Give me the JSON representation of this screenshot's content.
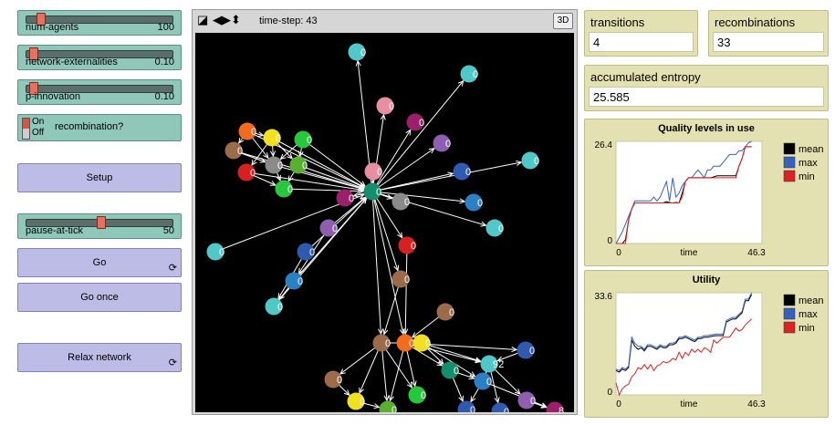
{
  "sliders": [
    {
      "name": "num-agents",
      "value": "100",
      "fraction": 0.12
    },
    {
      "name": "network-externalities",
      "value": "0.10",
      "fraction": 0.05
    },
    {
      "name": "p-innovation",
      "value": "0.10",
      "fraction": 0.05
    }
  ],
  "recombination_switch": {
    "on_label": "On",
    "off_label": "Off",
    "label": "recombination?",
    "state": "on"
  },
  "setup_button": {
    "label": "Setup"
  },
  "pause_slider": {
    "name": "pause-at-tick",
    "value": "50",
    "fraction": 0.5
  },
  "go_button": {
    "label": "Go",
    "forever_icon": "forever-icon"
  },
  "go_once_button": {
    "label": "Go once"
  },
  "relax_button": {
    "label": "Relax network",
    "forever_icon": "forever-icon"
  },
  "view": {
    "time_step": "time-step: 43",
    "three_d_label": "3D",
    "icons": [
      "turtle-shape-icon",
      "horizontal-arrows-icon",
      "vertical-arrows-icon"
    ],
    "nodes": [
      {
        "color": "#50c8c8",
        "label": "0"
      },
      {
        "color": "#50c8c8",
        "label": "0"
      },
      {
        "color": "#e88ea0",
        "label": "0"
      },
      {
        "color": "#9b1f6a",
        "label": "0"
      },
      {
        "color": "#8e5fb0",
        "label": "0"
      },
      {
        "color": "#f26b1e",
        "label": "0"
      },
      {
        "color": "#f0e020",
        "label": "0"
      },
      {
        "color": "#28c83c",
        "label": "0"
      },
      {
        "color": "#9c6b4a",
        "label": "0"
      },
      {
        "color": "#8a8a8a",
        "label": "0"
      },
      {
        "color": "#58b030",
        "label": "0"
      },
      {
        "color": "#d82020",
        "label": "0"
      },
      {
        "color": "#28c83c",
        "label": "0"
      },
      {
        "color": "#e88ea0",
        "label": "0"
      },
      {
        "color": "#50c8c8",
        "label": "0"
      },
      {
        "color": "#2f5ab0",
        "label": "0"
      },
      {
        "color": "#9b1f6a",
        "label": "0"
      },
      {
        "color": "#148f6e",
        "label": "0"
      },
      {
        "color": "#8a8a8a",
        "label": "0"
      },
      {
        "color": "#2b7fc4",
        "label": "0"
      },
      {
        "color": "#50c8c8",
        "label": "0"
      },
      {
        "color": "#8e5fb0",
        "label": "0"
      },
      {
        "color": "#50c8c8",
        "label": "0"
      },
      {
        "color": "#2f5ab0",
        "label": "0"
      },
      {
        "color": "#d82020",
        "label": "0"
      },
      {
        "color": "#2b7fc4",
        "label": "0"
      },
      {
        "color": "#9c6b4a",
        "label": "0"
      },
      {
        "color": "#50c8c8",
        "label": "0"
      },
      {
        "color": "#9c6b4a",
        "label": "0"
      },
      {
        "color": "#9c6b4a",
        "label": "0"
      },
      {
        "color": "#f26b1e",
        "label": "0"
      },
      {
        "color": "#f0e020",
        "label": "0"
      },
      {
        "color": "#148f6e",
        "label": "0"
      },
      {
        "color": "#50c8c8",
        "label": "92"
      },
      {
        "color": "#2f5ab0",
        "label": "0"
      },
      {
        "color": "#2b7fc4",
        "label": "0"
      },
      {
        "color": "#9c6b4a",
        "label": "0"
      },
      {
        "color": "#f0e020",
        "label": "0"
      },
      {
        "color": "#28c83c",
        "label": "0"
      },
      {
        "color": "#58b030",
        "label": "0"
      },
      {
        "color": "#2f5ab0",
        "label": "0"
      },
      {
        "color": "#2f5ab0",
        "label": "0"
      },
      {
        "color": "#8e5fb0",
        "label": "0"
      },
      {
        "color": "#9b1f6a",
        "label": "8"
      }
    ]
  },
  "monitors": {
    "transitions": {
      "label": "transitions",
      "value": "4"
    },
    "recombinations": {
      "label": "recombinations",
      "value": "33"
    },
    "entropy": {
      "label": "accumulated entropy",
      "value": "25.585"
    }
  },
  "chart_data": [
    {
      "type": "line",
      "title": "Quality levels in use",
      "xlabel": "time",
      "ylabel": "",
      "xlim": [
        0,
        46.3
      ],
      "ylim": [
        0,
        26.4
      ],
      "x_tick_labels": [
        "0",
        "46.3"
      ],
      "y_tick_labels": [
        "26.4",
        "0"
      ],
      "legend_position": "right",
      "series": [
        {
          "name": "mean",
          "color": "#000000",
          "x": [
            0,
            2,
            3,
            4,
            5,
            6,
            7,
            8,
            9,
            10,
            11,
            12,
            13,
            14,
            15,
            16,
            17,
            18,
            19,
            20,
            21,
            22,
            23,
            24,
            25,
            26,
            27,
            28,
            29,
            30,
            31,
            32,
            33,
            34,
            35,
            36,
            37,
            38,
            39,
            40,
            41,
            42,
            43
          ],
          "y": [
            0,
            0,
            1,
            6,
            9,
            10.5,
            10.5,
            10.5,
            10.5,
            10.5,
            10.5,
            10.5,
            10.5,
            10.5,
            10.5,
            10.8,
            10.6,
            10.5,
            10.6,
            10.5,
            13,
            16,
            17,
            17,
            17,
            17,
            17,
            17,
            17,
            17,
            17.2,
            17.5,
            17.5,
            17.5,
            17.5,
            17.5,
            17.5,
            17.5,
            20,
            22,
            25,
            25,
            25
          ]
        },
        {
          "name": "max",
          "color": "#3560c0",
          "x": [
            0,
            2,
            3,
            4,
            5,
            6,
            7,
            8,
            9,
            10,
            11,
            12,
            13,
            14,
            15,
            16,
            17,
            18,
            19,
            20,
            21,
            22,
            23,
            24,
            25,
            26,
            27,
            28,
            29,
            30,
            31,
            32,
            33,
            34,
            35,
            36,
            37,
            38,
            39,
            40,
            41,
            42,
            43
          ],
          "y": [
            0,
            3,
            5,
            7,
            9,
            11,
            11,
            11,
            11,
            11,
            11,
            12,
            11,
            12,
            14,
            16,
            11,
            17,
            12,
            13,
            15,
            16,
            17,
            17,
            18,
            19,
            18,
            17,
            19,
            19,
            20,
            20,
            20,
            21,
            22,
            23,
            23,
            23,
            24,
            24,
            25,
            26,
            26.4
          ]
        },
        {
          "name": "min",
          "color": "#dd2222",
          "x": [
            0,
            2,
            3,
            4,
            5,
            6,
            7,
            8,
            9,
            10,
            11,
            12,
            13,
            14,
            15,
            16,
            17,
            18,
            19,
            20,
            21,
            22,
            23,
            24,
            25,
            26,
            27,
            28,
            29,
            30,
            31,
            32,
            33,
            34,
            35,
            36,
            37,
            38,
            39,
            40,
            41,
            42,
            43
          ],
          "y": [
            0,
            0,
            0,
            6,
            9,
            10.5,
            10.5,
            10.5,
            10.5,
            10.5,
            10.5,
            10.5,
            10.5,
            10.5,
            10.5,
            10.5,
            10.5,
            10.5,
            10.5,
            10.5,
            12,
            16,
            17,
            17,
            17,
            17,
            17,
            17,
            17,
            17,
            17,
            17,
            17,
            17,
            17,
            17,
            17,
            17,
            20,
            22,
            25,
            25,
            25
          ]
        }
      ]
    },
    {
      "type": "line",
      "title": "Utility",
      "xlabel": "time",
      "ylabel": "",
      "xlim": [
        0,
        46.3
      ],
      "ylim": [
        0,
        33.6
      ],
      "x_tick_labels": [
        "0",
        "46.3"
      ],
      "y_tick_labels": [
        "33.6",
        "0"
      ],
      "legend_position": "right",
      "series": [
        {
          "name": "mean",
          "color": "#000000",
          "x": [
            0,
            1,
            2,
            3,
            4,
            5,
            6,
            7,
            8,
            9,
            10,
            11,
            12,
            13,
            14,
            15,
            16,
            17,
            18,
            19,
            20,
            21,
            22,
            23,
            24,
            25,
            26,
            27,
            28,
            29,
            30,
            31,
            32,
            33,
            34,
            35,
            36,
            37,
            38,
            39,
            40,
            41,
            42,
            43
          ],
          "y": [
            8,
            7.5,
            8.5,
            8,
            9,
            18,
            16,
            15,
            15.5,
            14.5,
            16,
            16,
            15.5,
            15,
            16,
            15.5,
            15.5,
            16.5,
            16.5,
            17,
            18.5,
            18.5,
            19,
            18.5,
            18,
            17.5,
            18.5,
            18.5,
            19,
            19,
            19.2,
            19.4,
            19.5,
            19.5,
            19.5,
            24,
            24.5,
            25,
            25,
            26,
            27,
            31,
            31,
            33
          ]
        },
        {
          "name": "max",
          "color": "#3560c0",
          "x": [
            0,
            1,
            2,
            3,
            4,
            5,
            6,
            7,
            8,
            9,
            10,
            11,
            12,
            13,
            14,
            15,
            16,
            17,
            18,
            19,
            20,
            21,
            22,
            23,
            24,
            25,
            26,
            27,
            28,
            29,
            30,
            31,
            32,
            33,
            34,
            35,
            36,
            37,
            38,
            39,
            40,
            41,
            42,
            43
          ],
          "y": [
            8.5,
            8,
            9,
            8.5,
            9.5,
            19,
            17,
            16,
            16,
            15,
            16.5,
            16.5,
            16,
            15.5,
            16.5,
            16,
            16,
            17,
            17,
            17.5,
            19,
            19,
            19.5,
            19,
            18.5,
            18,
            19,
            19,
            19.5,
            19.5,
            19.7,
            19.9,
            20,
            20,
            20,
            24.5,
            25,
            25.5,
            25.5,
            26.5,
            27.5,
            31.5,
            31.5,
            33.6
          ]
        },
        {
          "name": "min",
          "color": "#dd2222",
          "x": [
            0,
            1,
            2,
            3,
            4,
            5,
            6,
            7,
            8,
            9,
            10,
            11,
            12,
            13,
            14,
            15,
            16,
            17,
            18,
            19,
            20,
            21,
            22,
            23,
            24,
            25,
            26,
            27,
            28,
            29,
            30,
            31,
            32,
            33,
            34,
            35,
            36,
            37,
            38,
            39,
            40,
            41,
            42,
            43
          ],
          "y": [
            4,
            0,
            2,
            3,
            3.5,
            6,
            7,
            9,
            8.5,
            10,
            8.5,
            10,
            8,
            9.5,
            10,
            11,
            10.5,
            11,
            12,
            11.5,
            14,
            12,
            14,
            13,
            15,
            14,
            15,
            14,
            15.5,
            15,
            14,
            18,
            17,
            18,
            19,
            19,
            19,
            20.5,
            22,
            21,
            21.5,
            23,
            24,
            25
          ]
        }
      ]
    }
  ]
}
